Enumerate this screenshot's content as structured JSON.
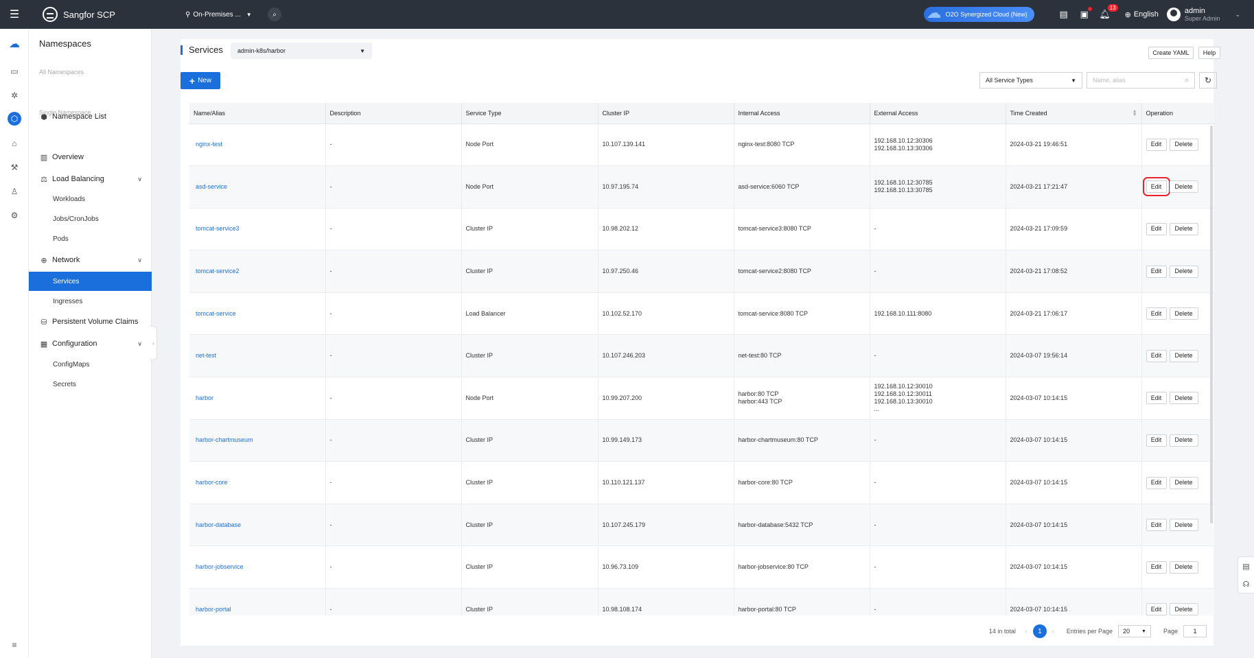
{
  "topbar": {
    "brand": "Sangfor SCP",
    "env_label": "On-Premises ...",
    "o2o_label": "O2O Synergized Cloud (New)",
    "alerts_count": "13",
    "language": "English",
    "user_name": "admin",
    "user_role": "Super Admin"
  },
  "nav": {
    "title": "Namespaces",
    "group_all": "All Namespaces",
    "namespace_list": "Namespace List",
    "group_single": "Single Namespace",
    "overview": "Overview",
    "load_balancing": "Load Balancing",
    "workloads": "Workloads",
    "jobs": "Jobs/CronJobs",
    "pods": "Pods",
    "network": "Network",
    "services": "Services",
    "ingresses": "Ingresses",
    "pvc": "Persistent Volume Claims",
    "configuration": "Configuration",
    "configmaps": "ConfigMaps",
    "secrets": "Secrets"
  },
  "page": {
    "title": "Services",
    "namespace": "admin-k8s/harbor",
    "create_yaml": "Create YAML",
    "help": "Help",
    "new_button": "New",
    "type_filter": "All Service Types",
    "search_placeholder": "Name, alias"
  },
  "table": {
    "headers": [
      "Name/Alias",
      "Description",
      "Service Type",
      "Cluster IP",
      "Internal Access",
      "External Access",
      "Time Created",
      "Operation"
    ],
    "edit_label": "Edit",
    "delete_label": "Delete",
    "rows": [
      {
        "name": "nginx-test",
        "desc": "-",
        "type": "Node Port",
        "ip": "10.107.139.141",
        "internal": "nginx-test:8080 TCP",
        "external": "192.168.10.12:30306\n192.168.10.13:30306",
        "time": "2024-03-21 19:46:51"
      },
      {
        "name": "asd-service",
        "desc": "-",
        "type": "Node Port",
        "ip": "10.97.195.74",
        "internal": "asd-service:6060 TCP",
        "external": "192.168.10.12:30785\n192.168.10.13:30785",
        "time": "2024-03-21 17:21:47"
      },
      {
        "name": "tomcat-service3",
        "desc": "-",
        "type": "Cluster IP",
        "ip": "10.98.202.12",
        "internal": "tomcat-service3:8080 TCP",
        "external": "-",
        "time": "2024-03-21 17:09:59"
      },
      {
        "name": "tomcat-service2",
        "desc": "-",
        "type": "Cluster IP",
        "ip": "10.97.250.46",
        "internal": "tomcat-service2:8080 TCP",
        "external": "-",
        "time": "2024-03-21 17:08:52"
      },
      {
        "name": "tomcat-service",
        "desc": "-",
        "type": "Load Balancer",
        "ip": "10.102.52.170",
        "internal": "tomcat-service:8080 TCP",
        "external": "192.168.10.111:8080",
        "time": "2024-03-21 17:06:17"
      },
      {
        "name": "net-test",
        "desc": "-",
        "type": "Cluster IP",
        "ip": "10.107.246.203",
        "internal": "net-test:80 TCP",
        "external": "-",
        "time": "2024-03-07 19:56:14"
      },
      {
        "name": "harbor",
        "desc": "-",
        "type": "Node Port",
        "ip": "10.99.207.200",
        "internal": "harbor:80 TCP\nharbor:443 TCP",
        "external": "192.168.10.12:30010\n192.168.10.12:30011\n192.168.10.13:30010\n...",
        "time": "2024-03-07 10:14:15"
      },
      {
        "name": "harbor-chartmuseum",
        "desc": "-",
        "type": "Cluster IP",
        "ip": "10.99.149.173",
        "internal": "harbor-chartmuseum:80 TCP",
        "external": "-",
        "time": "2024-03-07 10:14:15"
      },
      {
        "name": "harbor-core",
        "desc": "-",
        "type": "Cluster IP",
        "ip": "10.110.121.137",
        "internal": "harbor-core:80 TCP",
        "external": "-",
        "time": "2024-03-07 10:14:15"
      },
      {
        "name": "harbor-database",
        "desc": "-",
        "type": "Cluster IP",
        "ip": "10.107.245.179",
        "internal": "harbor-database:5432 TCP",
        "external": "-",
        "time": "2024-03-07 10:14:15"
      },
      {
        "name": "harbor-jobservice",
        "desc": "-",
        "type": "Cluster IP",
        "ip": "10.96.73.109",
        "internal": "harbor-jobservice:80 TCP",
        "external": "-",
        "time": "2024-03-07 10:14:15"
      },
      {
        "name": "harbor-portal",
        "desc": "-",
        "type": "Cluster IP",
        "ip": "10.98.108.174",
        "internal": "harbor-portal:80 TCP",
        "external": "-",
        "time": "2024-03-07 10:14:15"
      }
    ]
  },
  "pagination": {
    "total": "14 in total",
    "current": "1",
    "entries_label": "Entries per Page",
    "page_size": "20",
    "page_label": "Page",
    "page_input": "1"
  }
}
